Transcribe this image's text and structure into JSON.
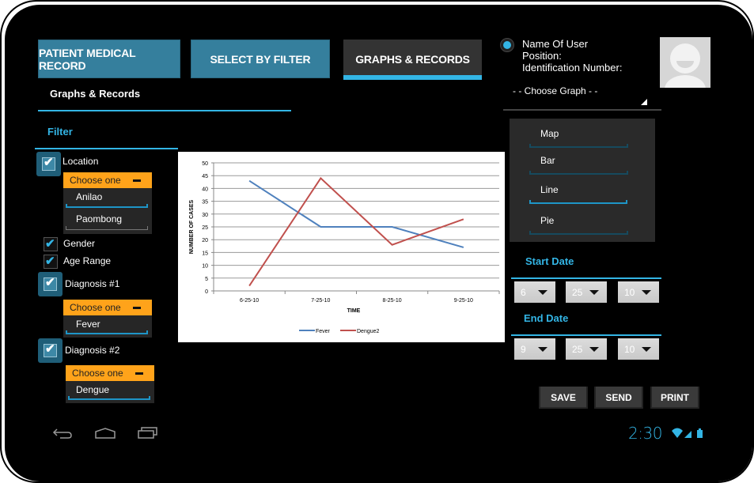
{
  "tabs": [
    {
      "label": "PATIENT MEDICAL RECORD",
      "active": false
    },
    {
      "label": "SELECT BY FILTER",
      "active": false
    },
    {
      "label": "GRAPHS & RECORDS",
      "active": true
    }
  ],
  "section_title": "Graphs & Records",
  "user": {
    "name_label": "Name Of User",
    "position_label": "Position:",
    "id_label": "Identification Number:"
  },
  "graph_select": {
    "placeholder": "- - Choose Graph - -",
    "options": [
      "Map",
      "Bar",
      "Line",
      "Pie"
    ],
    "selected": "Line"
  },
  "filter": {
    "title": "Filter",
    "location": {
      "label": "Location",
      "checked": true,
      "dropdown_label": "Choose one",
      "options": [
        "Anilao",
        "Paombong"
      ],
      "selected": "Anilao"
    },
    "gender": {
      "label": "Gender",
      "checked": true
    },
    "age_range": {
      "label": "Age Range",
      "checked": true
    },
    "diagnosis1": {
      "label": "Diagnosis #1",
      "checked": true,
      "dropdown_label": "Choose one",
      "options": [
        "Fever"
      ],
      "selected": "Fever"
    },
    "diagnosis2": {
      "label": "Diagnosis #2",
      "checked": true,
      "dropdown_label": "Choose one",
      "options": [
        "Dengue"
      ],
      "selected": "Dengue"
    }
  },
  "start_date": {
    "title": "Start Date",
    "month": "6",
    "day": "25",
    "year": "10"
  },
  "end_date": {
    "title": "End Date",
    "month": "9",
    "day": "25",
    "year": "10"
  },
  "buttons": {
    "save": "SAVE",
    "send": "SEND",
    "print": "PRINT"
  },
  "status_bar": {
    "time": "2:30",
    "accent": "#33b5e5"
  },
  "nav_icons": [
    "back-icon",
    "home-icon",
    "recent-apps-icon"
  ],
  "chart_data": {
    "type": "line",
    "title": "",
    "xlabel": "TIME",
    "ylabel": "NUMBER OF CASES",
    "categories": [
      "6-25-10",
      "7-25-10",
      "8-25-10",
      "9-25-10"
    ],
    "ylim": [
      0,
      50
    ],
    "yticks": [
      0,
      5,
      10,
      15,
      20,
      25,
      30,
      35,
      40,
      45,
      50
    ],
    "grid": true,
    "legend": "bottom",
    "series": [
      {
        "name": "Fever",
        "color": "#4f81bd",
        "values": [
          43,
          25,
          25,
          17
        ]
      },
      {
        "name": "Dengue2",
        "color": "#c0504d",
        "values": [
          2,
          44,
          18,
          28
        ]
      }
    ]
  }
}
